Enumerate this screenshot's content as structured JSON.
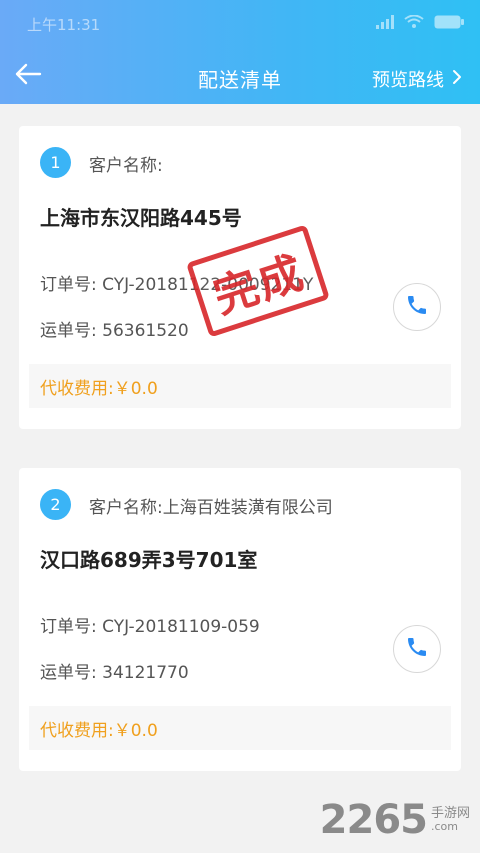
{
  "status_bar": {
    "time": "上午11:31",
    "colors": {
      "status": "#ffffff"
    }
  },
  "header": {
    "title": "配送清单",
    "right_action": "预览路线",
    "icons": {
      "back": "arrow-left-icon",
      "right": "chevron-right-icon"
    },
    "colors": {
      "gradient_start": "#6aaaf7",
      "gradient_end": "#2fc0f4"
    }
  },
  "orders": [
    {
      "index": "1",
      "customer_label": "客户名称:",
      "address": "上海市东汉阳路445号",
      "order_no_label": "订单号:",
      "order_no": "CYJ-20181122-0009211Y",
      "waybill_label": "运单号:",
      "waybill_no": "56361520",
      "fee_label": "代收费用:",
      "fee_value": "￥0.0",
      "stamp": "完成"
    },
    {
      "index": "2",
      "customer_label": "客户名称:上海百姓装潢有限公司",
      "address": "汉口路689弄3号701室",
      "order_no_label": "订单号:",
      "order_no": "CYJ-20181109-059",
      "waybill_label": "运单号:",
      "waybill_no": "34121770",
      "fee_label": "代收费用:",
      "fee_value": "￥0.0"
    }
  ],
  "watermark": {
    "number": "2265",
    "cn": "手游网",
    "domain": ".com"
  },
  "colors": {
    "accent": "#3ab4f6",
    "fee": "#f0a01e",
    "stamp": "#d8262a",
    "phone": "#2a8bf2"
  }
}
